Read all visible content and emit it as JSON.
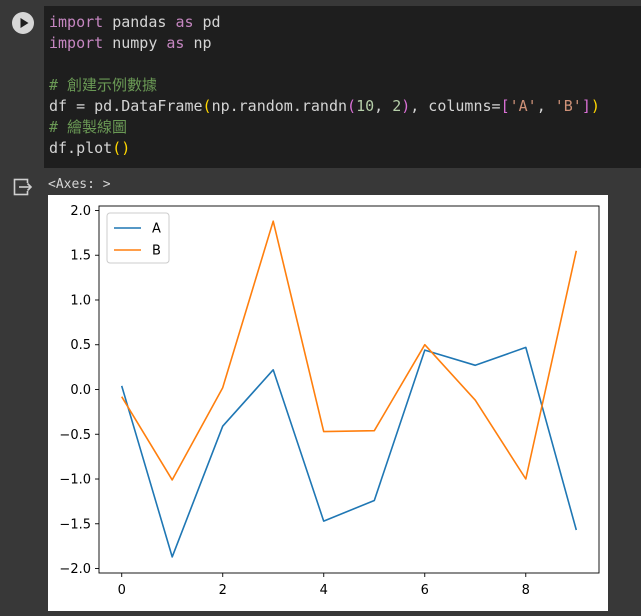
{
  "code_cell": {
    "run_button_icon": "play-icon",
    "lines": {
      "l1": {
        "kw1": "import",
        "t1": " pandas ",
        "kw2": "as",
        "t2": " pd"
      },
      "l2": {
        "kw1": "import",
        "t1": " numpy ",
        "kw2": "as",
        "t2": " np"
      },
      "l3": "# 創建示例數據",
      "l4": {
        "a": "df = pd.DataFrame",
        "p1": "(",
        "b": "np.random.randn",
        "p2": "(",
        "n1": "10",
        "c": ", ",
        "n2": "2",
        "p3": ")",
        "d": ", columns=",
        "b1": "[",
        "s1": "'A'",
        "e": ", ",
        "s2": "'B'",
        "b2": "]",
        "p4": ")"
      },
      "l5": "# 繪製線圖",
      "l6": {
        "a": "df.plot",
        "p": "()"
      }
    }
  },
  "output": {
    "icon": "output-redirect-icon",
    "text": "<Axes: >"
  },
  "chart_data": {
    "type": "line",
    "x": [
      0,
      1,
      2,
      3,
      4,
      5,
      6,
      7,
      8,
      9
    ],
    "xticks": [
      "0",
      "2",
      "4",
      "6",
      "8"
    ],
    "yticks": [
      "2.0",
      "1.5",
      "1.0",
      "0.5",
      "0.0",
      "−0.5",
      "−1.0",
      "−1.5",
      "−2.0"
    ],
    "ylim": [
      -2.05,
      2.05
    ],
    "xlim": [
      -0.45,
      9.45
    ],
    "legend_position": "upper-left",
    "grid": false,
    "series": [
      {
        "name": "A",
        "color": "#1f77b4",
        "values": [
          0.04,
          -1.87,
          -0.41,
          0.22,
          -1.47,
          -1.24,
          0.44,
          0.27,
          0.47,
          -1.57
        ]
      },
      {
        "name": "B",
        "color": "#ff7f0e",
        "values": [
          -0.08,
          -1.01,
          0.02,
          1.88,
          -0.47,
          -0.46,
          0.5,
          -0.12,
          -1.0,
          1.55
        ]
      }
    ]
  }
}
